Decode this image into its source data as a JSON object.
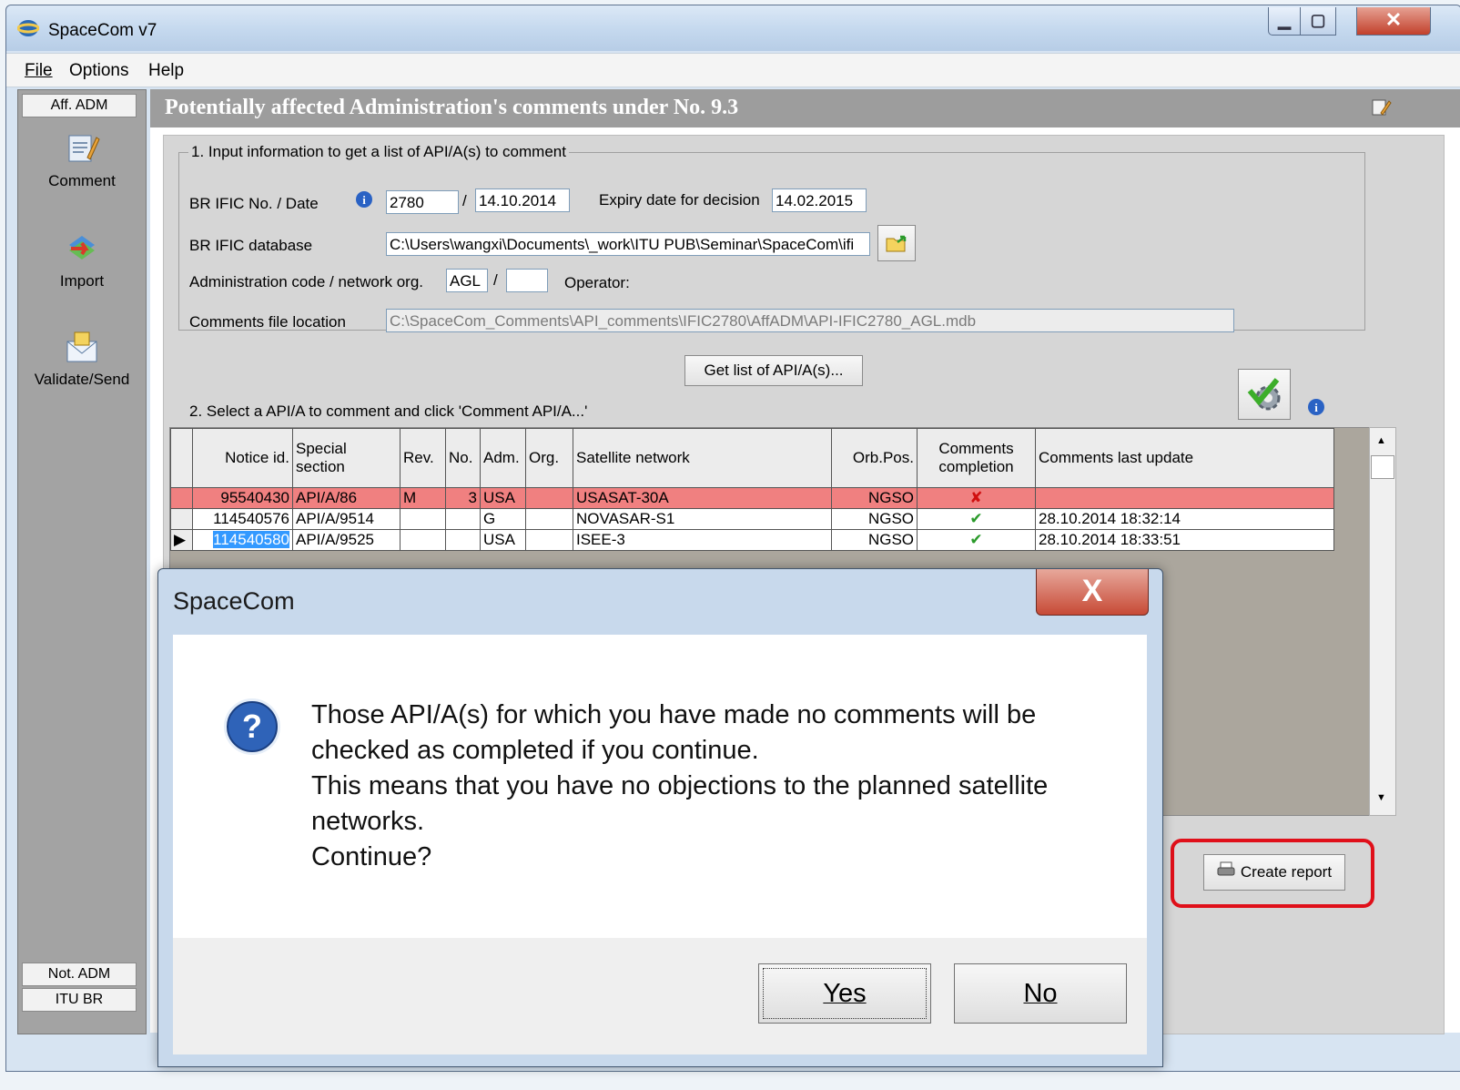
{
  "window": {
    "title": "SpaceCom v7"
  },
  "menu": [
    {
      "label": "File"
    },
    {
      "label": "Options"
    },
    {
      "label": "Help"
    }
  ],
  "sidebar": {
    "top_tab": "Aff. ADM",
    "items": [
      {
        "label": "Comment",
        "icon": "comment-icon"
      },
      {
        "label": "Import",
        "icon": "import-icon"
      },
      {
        "label": "Validate/Send",
        "icon": "envelope-icon"
      }
    ],
    "bottom_tabs": [
      "Not. ADM",
      "ITU BR"
    ]
  },
  "page": {
    "title": "Potentially affected Administration's comments under No. 9.3"
  },
  "section1": {
    "legend": "1. Input information to get a list of API/A(s) to comment",
    "br_ific_label": "BR IFIC No. / Date",
    "br_ific_no": "2780",
    "slash": "/",
    "br_ific_date": "14.10.2014",
    "expiry_label": "Expiry date for decision",
    "expiry_date": "14.02.2015",
    "db_label": "BR IFIC database",
    "db_path": "C:\\Users\\wangxi\\Documents\\_work\\ITU PUB\\Seminar\\SpaceCom\\ifi",
    "admin_label": "Administration code / network org.",
    "admin_code": "AGL",
    "network_org": "",
    "operator_label": "Operator:",
    "comments_file_label": "Comments file location",
    "comments_file_path": "C:\\SpaceCom_Comments\\API_comments\\IFIC2780\\AffADM\\API-IFIC2780_AGL.mdb"
  },
  "get_list_button": "Get list of API/A(s)...",
  "section2": {
    "label": "2. Select a API/A to comment and click 'Comment API/A...'"
  },
  "grid": {
    "columns": [
      "Notice id.",
      "Special section",
      "Rev.",
      "No.",
      "Adm.",
      "Org.",
      "Satellite network",
      "Orb.Pos.",
      "Comments completion",
      "Comments last update"
    ],
    "rows": [
      {
        "indicator": "",
        "notice_id": "95540430",
        "special_section": "API/A/86",
        "rev": "M",
        "no": "3",
        "adm": "USA",
        "org": "",
        "network": "USASAT-30A",
        "orb_pos": "NGSO",
        "completion": "✘",
        "last_update": ""
      },
      {
        "indicator": "",
        "notice_id": "114540576",
        "special_section": "API/A/9514",
        "rev": "",
        "no": "",
        "adm": "G",
        "org": "",
        "network": "NOVASAR-S1",
        "orb_pos": "NGSO",
        "completion": "✔",
        "last_update": "28.10.2014 18:32:14"
      },
      {
        "indicator": "▶",
        "notice_id": "114540580",
        "special_section": "API/A/9525",
        "rev": "",
        "no": "",
        "adm": "USA",
        "org": "",
        "network": "ISEE-3",
        "orb_pos": "NGSO",
        "completion": "✔",
        "last_update": "28.10.2014 18:33:51"
      }
    ]
  },
  "create_report_button": "Create report",
  "dialog": {
    "title": "SpaceCom",
    "close": "X",
    "lines": [
      "Those API/A(s) for which you have made no comments will be",
      "checked as completed if you continue.",
      "This means that you  have no objections to the planned satellite",
      "networks.",
      "Continue?"
    ],
    "yes": "Yes",
    "no": "No"
  },
  "colors": {
    "selected_row": "#f08080",
    "highlight_box": "#e0101a",
    "title_band": "#9d9d9d"
  }
}
